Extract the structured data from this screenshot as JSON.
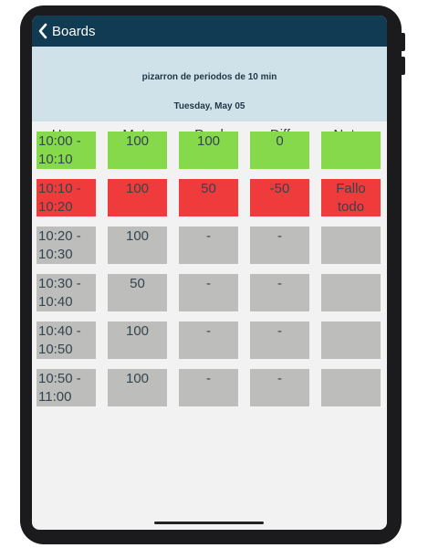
{
  "nav": {
    "back_label": "Boards"
  },
  "banner": {
    "title": "pizarron de periodos de 10 min",
    "date": "Tuesday, May 05"
  },
  "columns": [
    "Hora",
    "Meta",
    "Prod",
    "Diff",
    "Notas"
  ],
  "rows": [
    {
      "status": "green",
      "hora_1": "10:00 -",
      "hora_2": "10:10",
      "meta": "100",
      "prod": "100",
      "diff": "0",
      "notas_1": "",
      "notas_2": ""
    },
    {
      "status": "red",
      "hora_1": "10:10 -",
      "hora_2": "10:20",
      "meta": "100",
      "prod": "50",
      "diff": "-50",
      "notas_1": "Fallo",
      "notas_2": "todo"
    },
    {
      "status": "neutral",
      "hora_1": "10:20 -",
      "hora_2": "10:30",
      "meta": "100",
      "prod": "-",
      "diff": "-",
      "notas_1": "",
      "notas_2": ""
    },
    {
      "status": "neutral",
      "hora_1": "10:30 -",
      "hora_2": "10:40",
      "meta": "50",
      "prod": "-",
      "diff": "-",
      "notas_1": "",
      "notas_2": ""
    },
    {
      "status": "neutral",
      "hora_1": "10:40 -",
      "hora_2": "10:50",
      "meta": "100",
      "prod": "-",
      "diff": "-",
      "notas_1": "",
      "notas_2": ""
    },
    {
      "status": "neutral",
      "hora_1": "10:50 -",
      "hora_2": "11:00",
      "meta": "100",
      "prod": "-",
      "diff": "-",
      "notas_1": "",
      "notas_2": ""
    }
  ],
  "colors": {
    "nav": "#103b52",
    "banner": "#cfe2ea",
    "green": "#86d94a",
    "red": "#ef3b3b",
    "neutral": "#bdbdbb"
  },
  "icons": {
    "back": "chevron-left-icon"
  }
}
